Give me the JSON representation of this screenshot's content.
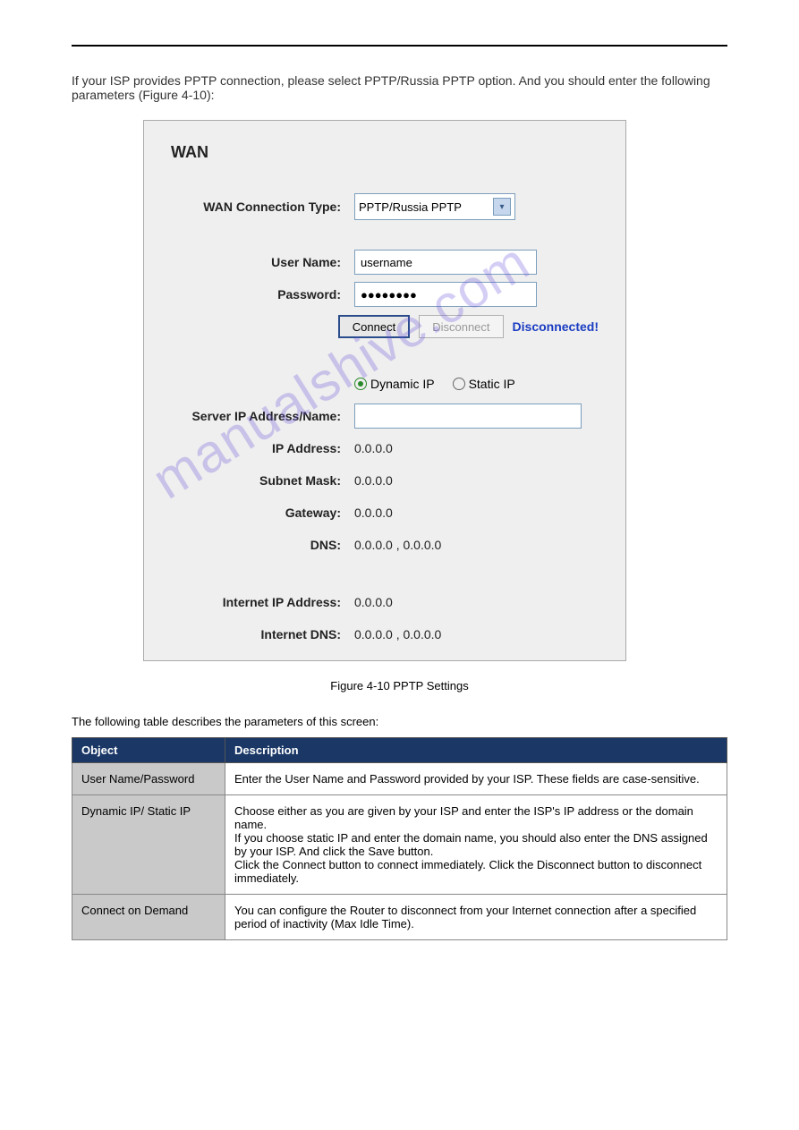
{
  "watermark": "manualshive.com",
  "intro": "If your ISP provides PPTP connection, please select PPTP/Russia PPTP option. And you should enter the following parameters (Figure 4-10):",
  "panel": {
    "title": "WAN",
    "labels": {
      "conn_type": "WAN Connection Type:",
      "user_name": "User Name:",
      "password": "Password:",
      "server": "Server IP Address/Name:",
      "ip_addr": "IP Address:",
      "subnet": "Subnet Mask:",
      "gateway": "Gateway:",
      "dns": "DNS:",
      "inet_ip": "Internet IP Address:",
      "inet_dns": "Internet DNS:"
    },
    "values": {
      "conn_type": "PPTP/Russia PPTP",
      "user_name": "username",
      "password": "●●●●●●●●",
      "server": "",
      "ip_addr": "0.0.0.0",
      "subnet": "0.0.0.0",
      "gateway": "0.0.0.0",
      "dns": "0.0.0.0 , 0.0.0.0",
      "inet_ip": "0.0.0.0",
      "inet_dns": "0.0.0.0 , 0.0.0.0"
    },
    "buttons": {
      "connect": "Connect",
      "disconnect": "Disconnect"
    },
    "status": "Disconnected!",
    "radios": {
      "dynamic": "Dynamic IP",
      "static": "Static IP"
    }
  },
  "caption": "Figure 4-10 PPTP Settings",
  "desc_intro": "The following table describes the parameters of this screen:",
  "table": {
    "headers": {
      "object": "Object",
      "description": "Description"
    },
    "rows": [
      {
        "object": "User Name/Password",
        "description": "Enter the User Name and Password provided by your ISP. These fields are case-sensitive."
      },
      {
        "object": "Dynamic IP/ Static IP",
        "description": "Choose either as you are given by your ISP and enter the ISP's IP address or the domain name.\nIf you choose static IP and enter the domain name, you should also enter the DNS assigned by your ISP. And click the Save button.\nClick the Connect button to connect immediately. Click the Disconnect button to disconnect immediately."
      },
      {
        "object": "Connect on Demand",
        "description": "You can configure the Router to disconnect from your Internet connection after a specified period of inactivity (Max Idle Time)."
      }
    ]
  }
}
